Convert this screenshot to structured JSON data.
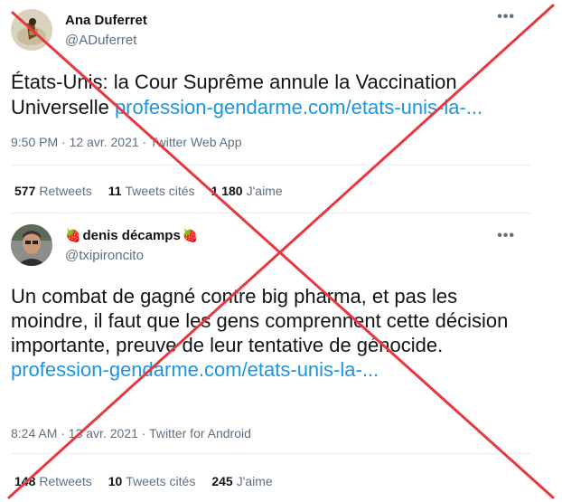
{
  "tweets": [
    {
      "name": "Ana Duferret",
      "handle": "@ADuferret",
      "more": "•••",
      "text": "États-Unis: la Cour Suprême annule la Vaccination Universelle ",
      "link": "profession-gendarme.com/etats-unis-la-...",
      "meta": "9:50 PM · 12 avr. 2021 · Twitter Web App",
      "retweets_count": "577",
      "retweets_label": "Retweets",
      "quotes_count": "11",
      "quotes_label": "Tweets cités",
      "likes_count": "1 180",
      "likes_label": "J'aime"
    },
    {
      "name": "denis décamps",
      "name_emoji": "🍓",
      "handle": "@txipironcito",
      "more": "•••",
      "text": "Un combat de gagné contre big pharma, et pas les moindre, il faut que les gens comprennent cette décision importante, preuve de leur tentative de génocide. ",
      "link": "profession-gendarme.com/etats-unis-la-...",
      "meta": "8:24 AM · 13 avr. 2021 · Twitter for Android",
      "retweets_count": "148",
      "retweets_label": "Retweets",
      "quotes_count": "10",
      "quotes_label": "Tweets cités",
      "likes_count": "245",
      "likes_label": "J'aime"
    }
  ],
  "colors": {
    "link": "#1b95e0",
    "cross": "#e8383f",
    "muted": "#5b7083"
  },
  "overlay": "red-x-cross"
}
